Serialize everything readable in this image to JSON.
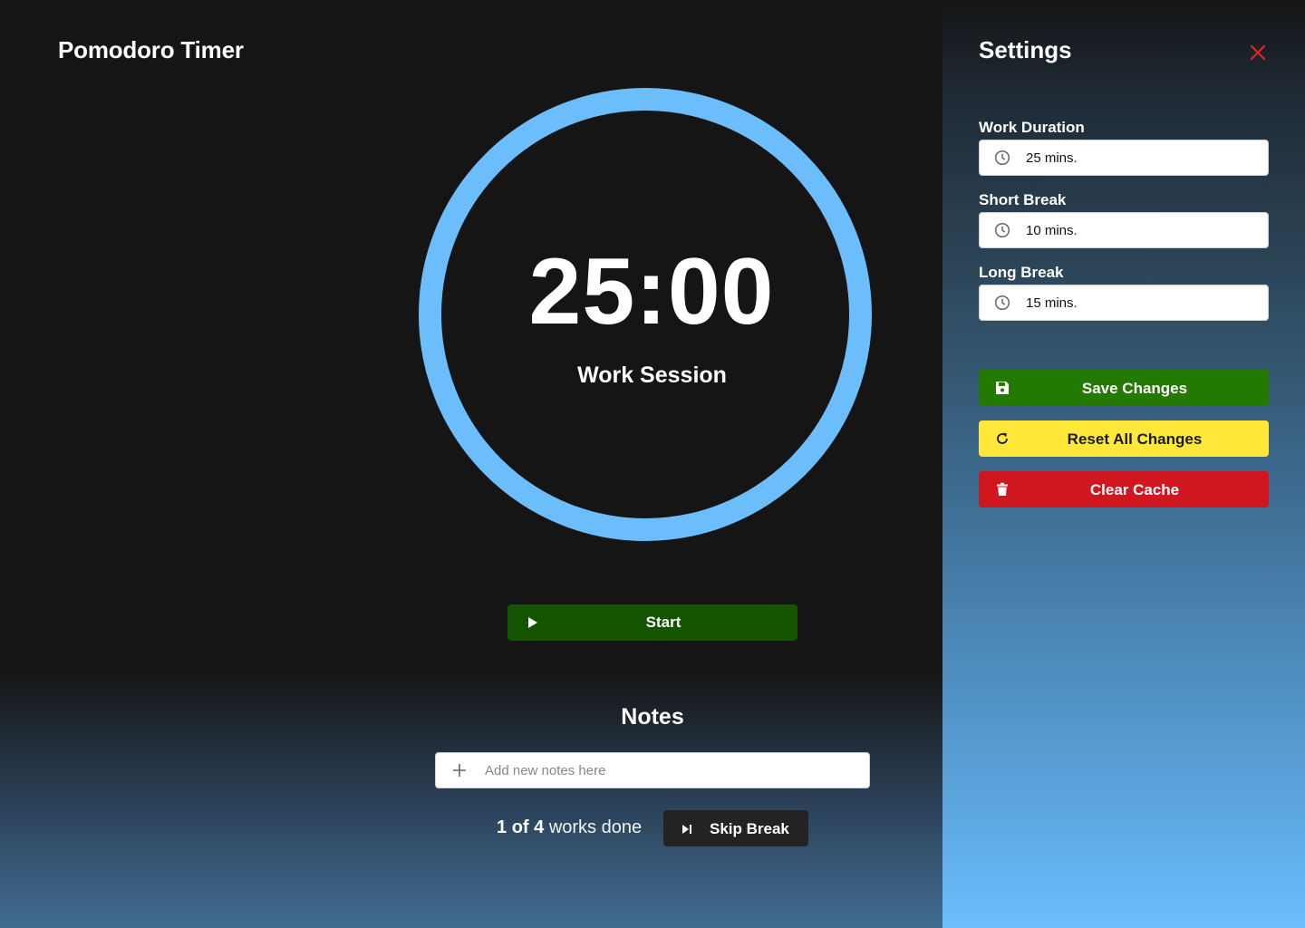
{
  "app": {
    "title": "Pomodoro Timer"
  },
  "timer": {
    "time": "25:00",
    "session_label": "Work Session",
    "ring_color": "#6bbdfc",
    "start_label": "Start"
  },
  "notes": {
    "title": "Notes",
    "placeholder": "Add new notes here",
    "value": ""
  },
  "progress": {
    "done": "1",
    "of_word": "of",
    "total": "4",
    "suffix": "works done",
    "skip_label": "Skip Break"
  },
  "settings": {
    "title": "Settings",
    "close_icon": "close-icon",
    "fields": [
      {
        "label": "Work Duration",
        "value": "25 mins."
      },
      {
        "label": "Short Break",
        "value": "10 mins."
      },
      {
        "label": "Long Break",
        "value": "15 mins."
      }
    ],
    "buttons": {
      "save_label": "Save Changes",
      "reset_label": "Reset All Changes",
      "clear_label": "Clear Cache"
    }
  },
  "colors": {
    "start_green": "#145300",
    "save_green": "#247a00",
    "reset_yellow": "#ffe83a",
    "clear_red": "#d0161f",
    "close_red": "#e0242a",
    "accent_blue": "#6bbdfc"
  }
}
